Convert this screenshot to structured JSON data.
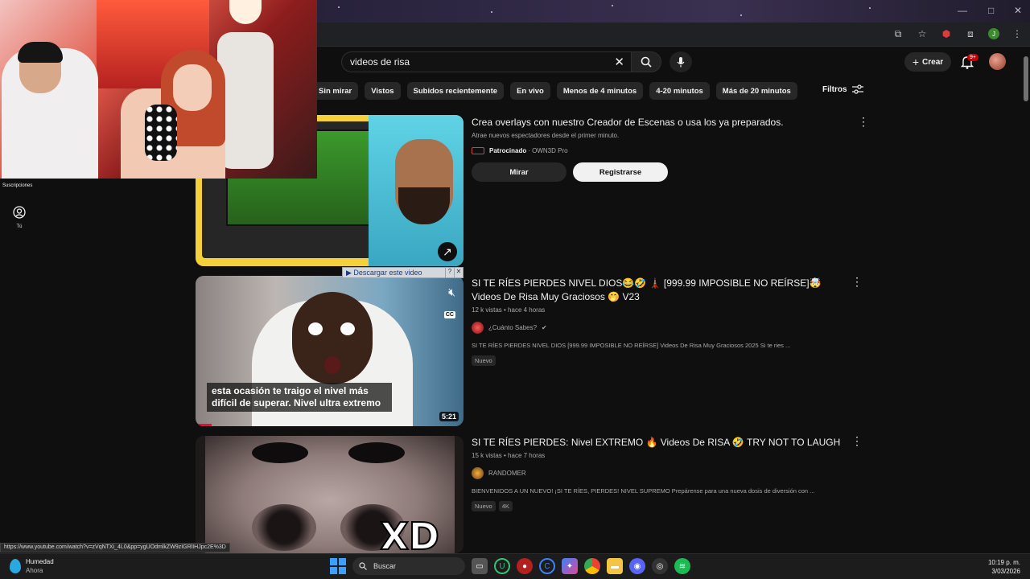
{
  "browser": {
    "win_controls": [
      "—",
      "□",
      "✕"
    ]
  },
  "header": {
    "search_value": "videos de risa",
    "create_label": "Crear",
    "notif_count": "9+"
  },
  "chips": [
    "Sin mirar",
    "Vistos",
    "Subidos recientemente",
    "En vivo",
    "Menos de 4 minutos",
    "4-20 minutos",
    "Más de 20 minutos"
  ],
  "filters_label": "Filtros",
  "sidebar": {
    "subscriptions_label": "Suscripciones",
    "you_label": "Tú"
  },
  "ad": {
    "title": "Crea overlays con nuestro Creador de Escenas o usa los ya preparados.",
    "subtitle": "Atrae nuevos espectadores desde el primer minuto.",
    "sponsored": "Patrocinado",
    "advertiser": "· OWN3D Pro",
    "watch_label": "Mirar",
    "register_label": "Registrarse"
  },
  "videos": [
    {
      "title": "SI TE RÍES PIERDES NIVEL DIOS😂🤣 🗼 [999.99 IMPOSIBLE NO REÍRSE]🤯 Videos De Risa Muy Graciosos 🤭 V23",
      "meta": "12 k vistas • hace 4 horas",
      "channel": "¿Cuánto Sabes?",
      "desc": "SI TE RÍES PIERDES NIVEL DIOS [999.99 IMPOSIBLE NO REÍRSE] Videos De Risa Muy Graciosos 2025 Si te ries ...",
      "badges": [
        "Nuevo"
      ],
      "caption": "esta ocasión te traigo el nivel más difícil de superar. Nivel ultra extremo",
      "duration": "5:21",
      "download_label": "▶ Descargar este video"
    },
    {
      "title": "SI TE RÍES PIERDES: Nivel EXTREMO 🔥 Videos De RISA 🤣 TRY NOT TO LAUGH",
      "meta": "15 k vistas • hace 7 horas",
      "channel": "RANDOMER",
      "desc": "BIENVENIDOS A UN NUEVO! ¡SI TE RÍES, PIERDES! NIVEL SUPREMO Prepárense para una nueva dosis de diversión con ...",
      "badges": [
        "Nuevo",
        "4K"
      ],
      "overlay_text": "XD"
    }
  ],
  "status_url": "https://www.youtube.com/watch?v=zVqNTXi_4L0&pp=ygUOdmlkZW9zIGRlIHJpc2E%3D",
  "taskbar": {
    "weather_title": "Humedad",
    "weather_sub": "Ahora",
    "search_label": "Buscar",
    "time": "10:19 p. m.",
    "date": "3/03/2026"
  },
  "colors": {
    "youtube_red": "#ff0033",
    "background": "#0f0f0f",
    "chip": "#272727"
  }
}
